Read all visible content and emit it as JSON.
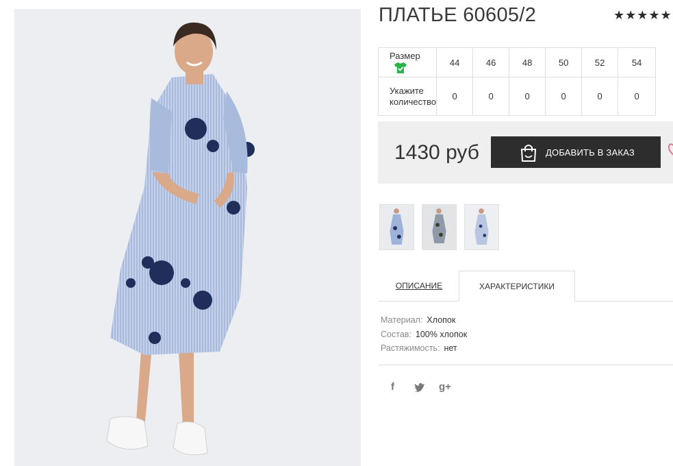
{
  "product": {
    "title": "ПЛАТЬЕ 60605/2",
    "rating": "★★★★★",
    "price": "1430 руб",
    "order_button": "ДОБАВИТЬ В ЗАКАЗ"
  },
  "sizes": {
    "size_label": "Размер",
    "qty_label_1": "Укажите",
    "qty_label_2": "количество",
    "values": [
      "44",
      "46",
      "48",
      "50",
      "52",
      "54"
    ],
    "quantities": [
      "0",
      "0",
      "0",
      "0",
      "0",
      "0"
    ]
  },
  "tabs": {
    "description": "ОПИСАНИЕ",
    "characteristics": "ХАРАКТЕРИСТИКИ"
  },
  "characteristics": [
    {
      "label": "Материал:",
      "value": "Хлопок"
    },
    {
      "label": "Состав:",
      "value": "100% хлопок"
    },
    {
      "label": "Растяжимость:",
      "value": "нет"
    }
  ],
  "social": {
    "facebook": "f",
    "twitter": "🐦",
    "googleplus": "g+"
  },
  "icons": [
    "shirt-check-icon",
    "shopping-bag-icon",
    "heart-icon",
    "facebook-icon",
    "twitter-icon",
    "google-plus-icon"
  ],
  "colors": {
    "accent_dark": "#2d2d2d",
    "shirt_icon_green": "#2bb34a",
    "price_bg": "#efefef"
  }
}
